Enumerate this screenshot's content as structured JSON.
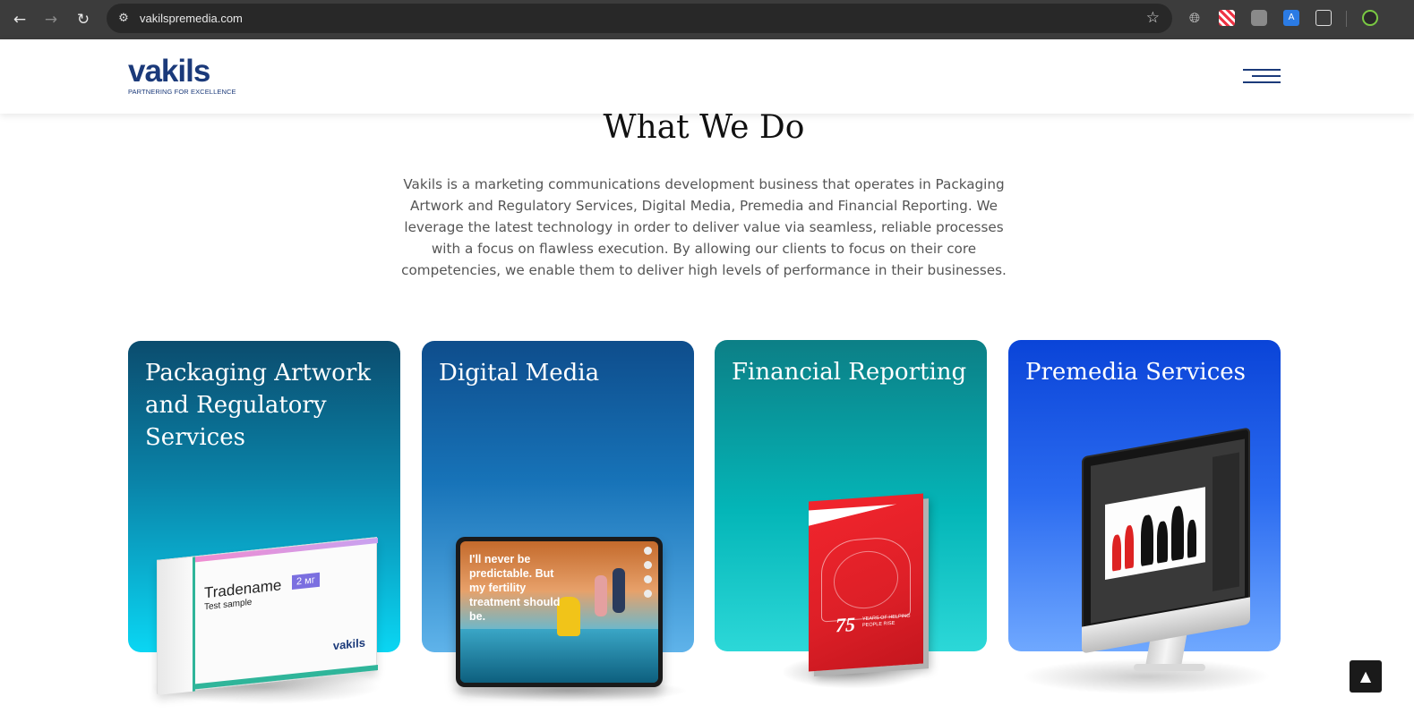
{
  "browser": {
    "back_icon": "←",
    "forward_icon": "→",
    "reload_icon": "↻",
    "site_info_icon": "⚙",
    "url": "vakilspremedia.com",
    "bookmark_icon": "☆",
    "extensions": [
      "globe-icon",
      "grid-extension-icon",
      "video-extension-icon",
      "translate-extension-icon",
      "puzzle-icon",
      "profile-avatar"
    ]
  },
  "header": {
    "logo_text": "vakils",
    "logo_tagline": "PARTNERING FOR EXCELLENCE",
    "brand_color": "#1b3a7a"
  },
  "section": {
    "title": "What We Do",
    "intro": "Vakils is a marketing communications development business that operates in Packaging Artwork and Regulatory Services, Digital Media, Premedia and Financial Reporting. We leverage the latest technology in order to deliver value via seamless, reliable processes with a focus on flawless execution. By allowing our clients to focus on their core competencies, we enable them to deliver high levels of performance in their businesses."
  },
  "cards": [
    {
      "title": "Packaging Artwork and Regulatory Services",
      "illustration": {
        "tradename": "Tradename",
        "dose": "2 мг",
        "subtitle": "Test sample",
        "brand": "vakils"
      }
    },
    {
      "title": "Digital Media",
      "illustration": {
        "copy": "I'll never be predictable. But my fertility treatment should be."
      }
    },
    {
      "title": "Financial Reporting",
      "illustration": {
        "number": "75",
        "caption": "YEARS OF HELPING PEOPLE RISE"
      }
    },
    {
      "title": "Premedia Services"
    }
  ],
  "scroll_top": {
    "icon": "▲"
  }
}
